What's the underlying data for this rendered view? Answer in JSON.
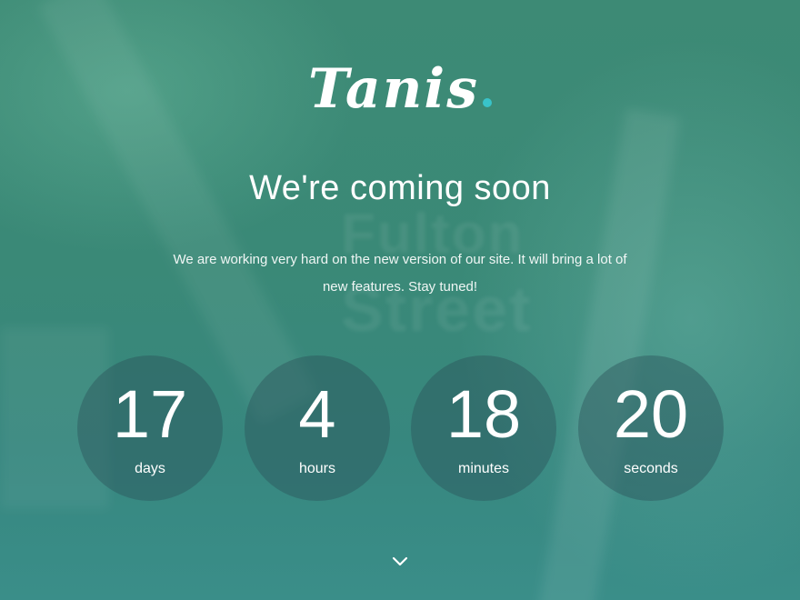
{
  "brand": {
    "name": "Tanis",
    "dot_color": "#39c3c9"
  },
  "hero": {
    "title": "We're coming soon",
    "description": "We are working very hard on the new version of our site. It will bring a lot of new features. Stay tuned!"
  },
  "countdown": [
    {
      "value": "17",
      "unit": "days"
    },
    {
      "value": "4",
      "unit": "hours"
    },
    {
      "value": "18",
      "unit": "minutes"
    },
    {
      "value": "20",
      "unit": "seconds"
    }
  ],
  "scroll_icon": "chevron-down-icon",
  "colors": {
    "background": "#3a8977",
    "circle": "#2d555a"
  }
}
